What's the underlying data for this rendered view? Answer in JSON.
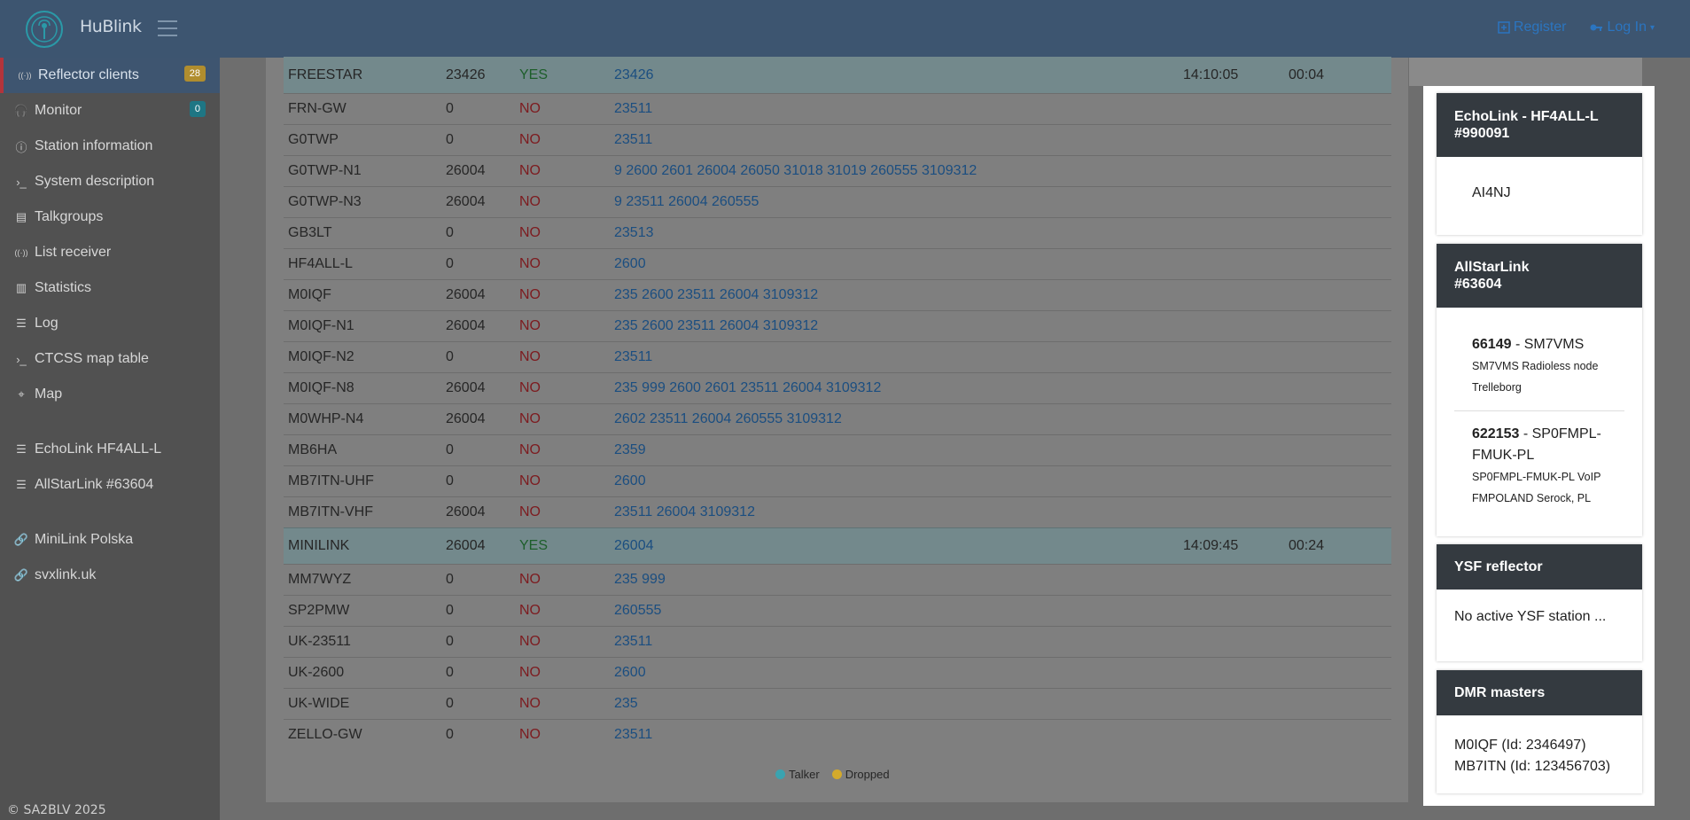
{
  "header": {
    "brand": "HuBlink",
    "register": "Register",
    "login": "Log In"
  },
  "sidebar": {
    "items": [
      {
        "label": "Reflector clients",
        "icon": "antenna-icon",
        "badge": "28"
      },
      {
        "label": "Monitor",
        "icon": "headphones-icon",
        "badge": "0"
      },
      {
        "label": "Station information",
        "icon": "info-icon"
      },
      {
        "label": "System description",
        "icon": "terminal-icon"
      },
      {
        "label": "Talkgroups",
        "icon": "book-icon"
      },
      {
        "label": "List receiver",
        "icon": "antenna-icon"
      },
      {
        "label": "Statistics",
        "icon": "chart-icon"
      },
      {
        "label": "Log",
        "icon": "list-icon"
      },
      {
        "label": "CTCSS map table",
        "icon": "terminal-icon"
      },
      {
        "label": "Map",
        "icon": "map-icon"
      },
      {
        "label": "EchoLink HF4ALL-L",
        "icon": "list-icon"
      },
      {
        "label": "AllStarLink #63604",
        "icon": "list-icon"
      },
      {
        "label": "MiniLink Polska",
        "icon": "link-icon"
      },
      {
        "label": "svxlink.uk",
        "icon": "link-icon"
      }
    ],
    "copyright": "© SA2BLV 2025"
  },
  "clients": [
    {
      "call": "FREESTAR",
      "tg": "23426",
      "active": "YES",
      "monitored": "23426",
      "time": "14:10:05",
      "dur": "00:04"
    },
    {
      "call": "FRN-GW",
      "tg": "0",
      "active": "NO",
      "monitored": "23511",
      "time": "",
      "dur": ""
    },
    {
      "call": "G0TWP",
      "tg": "0",
      "active": "NO",
      "monitored": "23511",
      "time": "",
      "dur": ""
    },
    {
      "call": "G0TWP-N1",
      "tg": "26004",
      "active": "NO",
      "monitored": "9 2600 2601 26004 26050 31018 31019 260555 3109312",
      "time": "",
      "dur": ""
    },
    {
      "call": "G0TWP-N3",
      "tg": "26004",
      "active": "NO",
      "monitored": "9 23511 26004 260555",
      "time": "",
      "dur": ""
    },
    {
      "call": "GB3LT",
      "tg": "0",
      "active": "NO",
      "monitored": "23513",
      "time": "",
      "dur": ""
    },
    {
      "call": "HF4ALL-L",
      "tg": "0",
      "active": "NO",
      "monitored": "2600",
      "time": "",
      "dur": ""
    },
    {
      "call": "M0IQF",
      "tg": "26004",
      "active": "NO",
      "monitored": "235 2600 23511 26004 3109312",
      "time": "",
      "dur": ""
    },
    {
      "call": "M0IQF-N1",
      "tg": "26004",
      "active": "NO",
      "monitored": "235 2600 23511 26004 3109312",
      "time": "",
      "dur": ""
    },
    {
      "call": "M0IQF-N2",
      "tg": "0",
      "active": "NO",
      "monitored": "23511",
      "time": "",
      "dur": ""
    },
    {
      "call": "M0IQF-N8",
      "tg": "26004",
      "active": "NO",
      "monitored": "235 999 2600 2601 23511 26004 3109312",
      "time": "",
      "dur": ""
    },
    {
      "call": "M0WHP-N4",
      "tg": "26004",
      "active": "NO",
      "monitored": "2602 23511 26004 260555 3109312",
      "time": "",
      "dur": ""
    },
    {
      "call": "MB6HA",
      "tg": "0",
      "active": "NO",
      "monitored": "2359",
      "time": "",
      "dur": ""
    },
    {
      "call": "MB7ITN-UHF",
      "tg": "0",
      "active": "NO",
      "monitored": "2600",
      "time": "",
      "dur": ""
    },
    {
      "call": "MB7ITN-VHF",
      "tg": "26004",
      "active": "NO",
      "monitored": "23511 26004 3109312",
      "time": "",
      "dur": ""
    },
    {
      "call": "MINILINK",
      "tg": "26004",
      "active": "YES",
      "monitored": "26004",
      "time": "14:09:45",
      "dur": "00:24"
    },
    {
      "call": "MM7WYZ",
      "tg": "0",
      "active": "NO",
      "monitored": "235 999",
      "time": "",
      "dur": ""
    },
    {
      "call": "SP2PMW",
      "tg": "0",
      "active": "NO",
      "monitored": "260555",
      "time": "",
      "dur": ""
    },
    {
      "call": "UK-23511",
      "tg": "0",
      "active": "NO",
      "monitored": "23511",
      "time": "",
      "dur": ""
    },
    {
      "call": "UK-2600",
      "tg": "0",
      "active": "NO",
      "monitored": "2600",
      "time": "",
      "dur": ""
    },
    {
      "call": "UK-WIDE",
      "tg": "0",
      "active": "NO",
      "monitored": "235",
      "time": "",
      "dur": ""
    },
    {
      "call": "ZELLO-GW",
      "tg": "0",
      "active": "NO",
      "monitored": "23511",
      "time": "",
      "dur": ""
    }
  ],
  "legend": {
    "talker": "Talker",
    "dropped": "Dropped",
    "talker_color": "#3aa3b0",
    "dropped_color": "#d4aa2c"
  },
  "panels": {
    "echolink": {
      "title1": "EchoLink - HF4ALL-L",
      "title2": "#990091",
      "station": "AI4NJ"
    },
    "allstar": {
      "title1": "AllStarLink",
      "title2": "#63604",
      "nodes": [
        {
          "id": "66149",
          "call": "SM7VMS",
          "desc1": "SM7VMS Radioless node",
          "desc2": "Trelleborg"
        },
        {
          "id": "622153",
          "call": "SP0FMPL-FMUK-PL",
          "desc1": "SP0FMPL-FMUK-PL VoIP",
          "desc2": "FMPOLAND Serock, PL"
        }
      ]
    },
    "ysf": {
      "title": "YSF reflector",
      "text": "No active YSF station ..."
    },
    "dmr": {
      "title": "DMR masters",
      "line1": "M0IQF (Id: 2346497)",
      "line2": "MB7ITN (Id: 123456703)"
    }
  }
}
